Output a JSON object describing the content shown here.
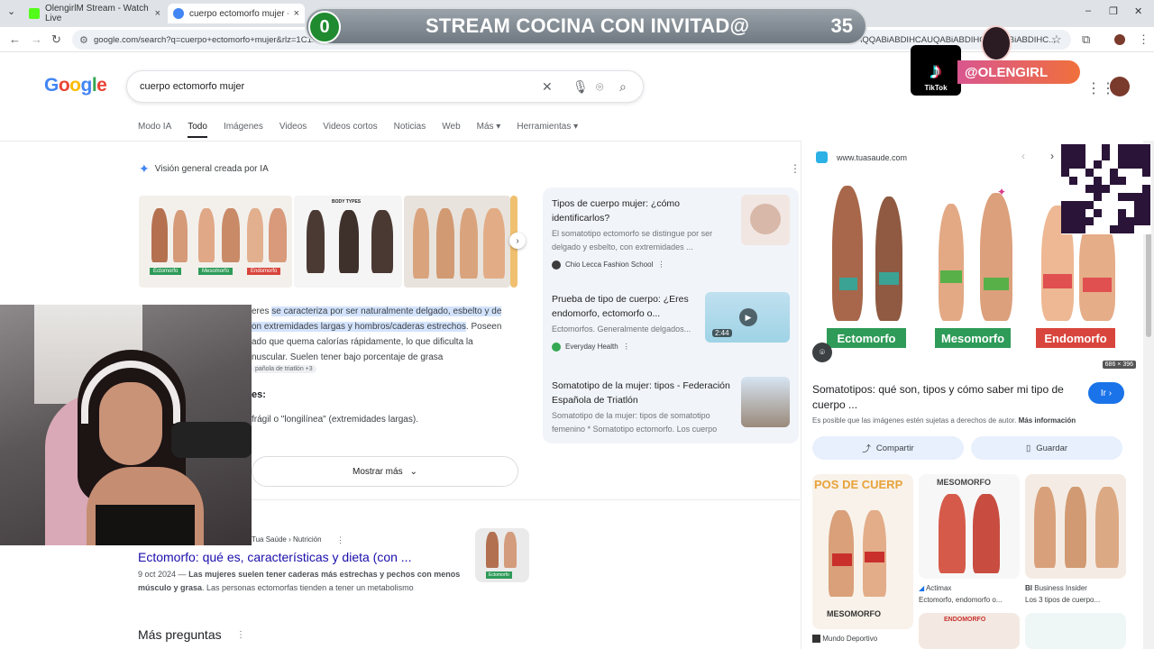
{
  "browser": {
    "tabs": [
      {
        "title": "OlengirlM Stream - Watch Live",
        "close": "×"
      },
      {
        "title": "cuerpo ectomorfo mujer - Busc",
        "close": "×"
      }
    ],
    "new_tab": "+",
    "url": "google.com/search?q=cuerpo+ectomorfo+mujer&rlz=1C1...PE991PE991&oq=cuerpo+ecto&gs_lcrp=EgZjaHJvbWUqBwgBEAAYgAQyBwgAEAAYgAQyBwgBEAAYgAQyCEAAYgAQyBggDEEUYOTIHCAQQABiABDIHCAUQABiABDIHCAYQABiABDIHC...",
    "window_controls": [
      "–",
      "❐",
      "✕"
    ]
  },
  "overlay": {
    "counter": "0",
    "banner_title": "STREAM COCINA CON INVITAD@",
    "banner_number": "35",
    "tiktok_label": "TikTok",
    "handle": "@OLENGIRL"
  },
  "google": {
    "logo_letters": [
      "G",
      "o",
      "o",
      "g",
      "l",
      "e"
    ],
    "query": "cuerpo ectomorfo mujer",
    "tabs": [
      "Modo IA",
      "Todo",
      "Imágenes",
      "Videos",
      "Videos cortos",
      "Noticias",
      "Web",
      "Más ▾",
      "Herramientas ▾"
    ],
    "active_tab": "Todo"
  },
  "ai_overview": {
    "heading": "Visión general creada por IA",
    "text_lines": [
      {
        "pre": "eres ",
        "hl": "se caracteriza por ser naturalmente delgado, esbelto y de",
        "post": ""
      },
      {
        "pre": "",
        "hl": "on extremidades largas y hombros/caderas estrechos",
        "post": ". Poseen"
      },
      {
        "pre": "ado que quema calorías rápidamente, lo que dificulta la",
        "hl": "",
        "post": ""
      },
      {
        "pre": "nuscular. Suelen tener bajo porcentaje de grasa",
        "hl": "",
        "post": ""
      }
    ],
    "source_chip": "pañola de triatlón +3",
    "subheading": "es:",
    "bullet": "frágil o \"longilínea\" (extremidades largas).",
    "more_button": "Mostrar más",
    "sources": [
      {
        "title": "Tipos de cuerpo mujer: ¿cómo identificarlos?",
        "desc": "El somatotipo ectomorfo se distingue por ser delgado y esbelto, con extremidades ...",
        "site": "Chio Lecca Fashion School"
      },
      {
        "title": "Prueba de tipo de cuerpo: ¿Eres endomorfo, ectomorfo o...",
        "desc": "Ectomorfos. Generalmente delgados...",
        "site": "Everyday Health",
        "duration": "2:44"
      },
      {
        "title": "Somatotipo de la mujer: tipos - Federación Española de Triatlón",
        "desc": "Somatotipo de la mujer: tipos de somatotipo femenino * Somatotipo ectomorfo. Los cuerpo",
        "site": ""
      }
    ],
    "image_labels": [
      "Ectomorfo",
      "Mesomorfo",
      "Endomorfo"
    ],
    "body_types_label": "BODY TYPES"
  },
  "result": {
    "site": "Tua Saúde › Nutrición",
    "title": "Ectomorfo: qué es, características y dieta (con ...",
    "date": "9 oct 2024",
    "snippet_bold": "Las mujeres suelen tener caderas más estrechas y pechos con menos músculo y grasa",
    "snippet_rest": ". Las personas ectomorfas tienden a tener un metabolismo",
    "thumb_label": "Ectomorfo"
  },
  "people_also_ask": "Más preguntas",
  "side_panel": {
    "domain": "www.tuasaude.com",
    "labels": [
      "Ectomorfo",
      "Mesomorfo",
      "Endomorfo"
    ],
    "dimensions": "686 × 396",
    "title": "Somatotipos: qué son, tipos y cómo saber mi tipo de cuerpo ...",
    "go_button": "Ir",
    "note": "Es posible que las imágenes estén sujetas a derechos de autor.",
    "note_link": "Más información",
    "share": "Compartir",
    "save": "Guardar",
    "grid": [
      {
        "banner": "POS DE CUERP",
        "bottom": "MESOMORFO",
        "source": "Mundo Deportivo",
        "caption": ""
      },
      {
        "banner": "MESOMORFO",
        "source": "Actimax",
        "caption": "Ectomorfo, endomorfo o..."
      },
      {
        "banner": "",
        "source": "Business Insider",
        "caption": "Los 3 tipos de cuerpo..."
      }
    ],
    "endomorfo_small": "ENDOMORFO"
  },
  "colors": {
    "accent_blue": "#1a73e8",
    "link": "#1a0dab",
    "green_label": "#2e9b58",
    "red_label": "#d8453c"
  }
}
